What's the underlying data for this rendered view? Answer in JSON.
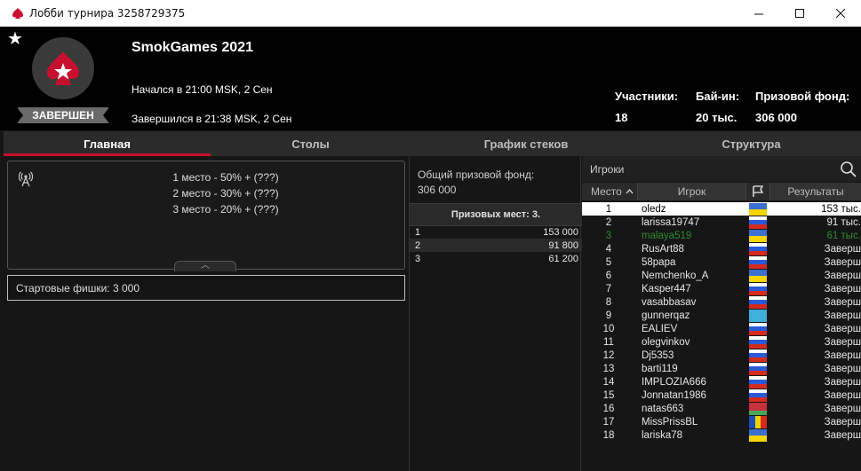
{
  "window": {
    "title": "Лобби турнира 3258729375",
    "controls": {
      "minimize": "—",
      "maximize": "☐",
      "close": "✕"
    }
  },
  "header": {
    "tournament_name": "SmokGames 2021",
    "status": "ЗАВЕРШЕН",
    "started": "Начался в 21:00 MSK, 2 Сен",
    "ended": "Завершился в 21:38 MSK, 2 Сен",
    "stats": [
      {
        "label": "Участники:",
        "value": "18"
      },
      {
        "label": "Бай-ин:",
        "value": "20 тыс."
      },
      {
        "label": "Призовой фонд:",
        "value": "306 000"
      }
    ],
    "brand_color": "#c8102e"
  },
  "tabs": [
    {
      "label": "Главная",
      "active": true
    },
    {
      "label": "Столы",
      "active": false
    },
    {
      "label": "График стеков",
      "active": false
    },
    {
      "label": "Структура",
      "active": false
    }
  ],
  "payouts": {
    "lines": [
      "1 место - 50% + (???)",
      "2 место - 30% + (???)",
      "3 место - 20% + (???)"
    ],
    "collapse_glyph": "︿",
    "starting_chips": "Стартовые фишки:  3 000"
  },
  "prize_pool": {
    "label": "Общий призовой фонд:",
    "value": "306 000",
    "paid_places": "Призовых мест: 3.",
    "rows": [
      {
        "place": "1",
        "amount": "153 000"
      },
      {
        "place": "2",
        "amount": "91 800"
      },
      {
        "place": "3",
        "amount": "61 200"
      }
    ]
  },
  "players": {
    "title": "Игроки",
    "columns": {
      "place": "Место",
      "player": "Игрок",
      "results": "Результаты"
    },
    "rows": [
      {
        "place": "1",
        "name": "oledz",
        "flag": "ua",
        "result": "153 тыс."
      },
      {
        "place": "2",
        "name": "larissa19747",
        "flag": "ru",
        "result": "91 тыс."
      },
      {
        "place": "3",
        "name": "malaya519",
        "flag": "ua",
        "result": "61 тыс."
      },
      {
        "place": "4",
        "name": "RusArt88",
        "flag": "ru",
        "result": "Заверш"
      },
      {
        "place": "5",
        "name": "58papa",
        "flag": "ru",
        "result": "Заверш"
      },
      {
        "place": "6",
        "name": "Nemchenko_A",
        "flag": "ua",
        "result": "Заверш"
      },
      {
        "place": "7",
        "name": "Kasper447",
        "flag": "ru",
        "result": "Заверш"
      },
      {
        "place": "8",
        "name": "vasabbasav",
        "flag": "ru",
        "result": "Заверш"
      },
      {
        "place": "9",
        "name": "gunnerqaz",
        "flag": "kz",
        "result": "Заверш"
      },
      {
        "place": "10",
        "name": "EALIEV",
        "flag": "ru",
        "result": "Заверш"
      },
      {
        "place": "11",
        "name": "olegvinkov",
        "flag": "ru",
        "result": "Заверш"
      },
      {
        "place": "12",
        "name": "Dj5353",
        "flag": "ru",
        "result": "Заверш"
      },
      {
        "place": "13",
        "name": "barti119",
        "flag": "ru",
        "result": "Заверш"
      },
      {
        "place": "14",
        "name": "IMPLOZIA666",
        "flag": "ru",
        "result": "Заверш"
      },
      {
        "place": "15",
        "name": "Jonnatan1986",
        "flag": "ru",
        "result": "Заверш"
      },
      {
        "place": "16",
        "name": "natas663",
        "flag": "by",
        "result": "Заверш"
      },
      {
        "place": "17",
        "name": "MissPrissBL",
        "flag": "md",
        "result": "Заверш"
      },
      {
        "place": "18",
        "name": "lariska78",
        "flag": "ua",
        "result": "Заверш"
      }
    ]
  }
}
